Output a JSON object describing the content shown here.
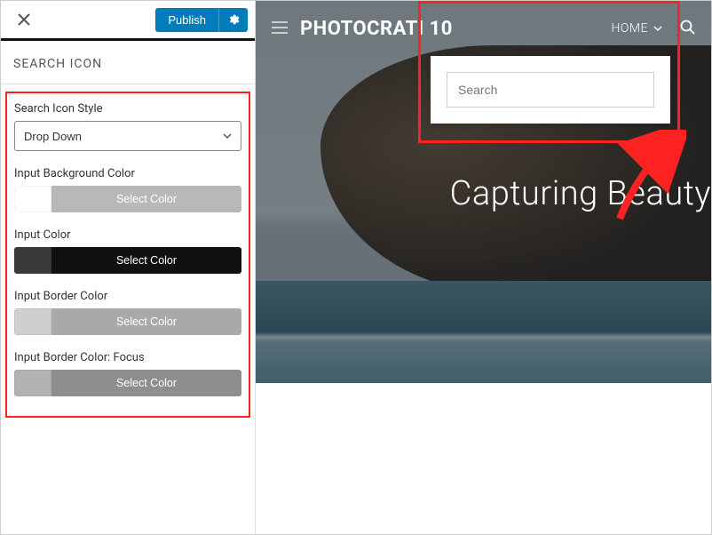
{
  "sidebar": {
    "publish_label": "Publish",
    "panel_title": "SEARCH ICON",
    "style_label": "Search Icon Style",
    "style_value": "Drop Down",
    "colors": [
      {
        "label": "Input Background Color",
        "swatch": "#ffffff",
        "btn_bg": "#b8b8b8",
        "btn_text": "Select Color"
      },
      {
        "label": "Input Color",
        "swatch": "#3a3a3a",
        "btn_bg": "#111111",
        "btn_text": "Select Color"
      },
      {
        "label": "Input Border Color",
        "swatch": "#cfcfcf",
        "btn_bg": "#a9a9a9",
        "btn_text": "Select Color"
      },
      {
        "label": "Input Border Color: Focus",
        "swatch": "#b2b2b2",
        "btn_bg": "#8e8e8e",
        "btn_text": "Select Color"
      }
    ]
  },
  "preview": {
    "brand": "PHOTOCRATI 10",
    "nav_home": "HOME",
    "search_placeholder": "Search",
    "hero": "Capturing Beauty"
  }
}
